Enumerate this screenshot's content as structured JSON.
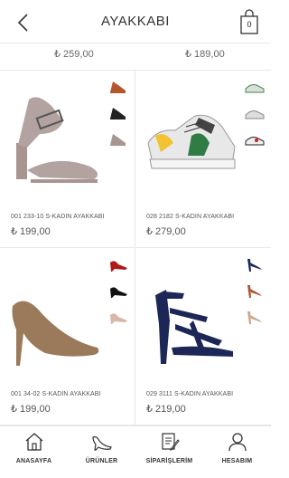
{
  "header": {
    "title": "AYAKKABI",
    "cart_count": "0"
  },
  "previous_row": {
    "prices": [
      "₺ 259,00",
      "₺ 189,00"
    ]
  },
  "products": [
    {
      "name": "001 233-10 S-KADIN AYAKKABI",
      "price": "₺ 199,00",
      "image": "block-heel-sandal-icon",
      "colors": [
        "#b5562c",
        "#222222",
        "#a89592"
      ]
    },
    {
      "name": "028 2182 S-KADIN AYAKKABI",
      "price": "₺ 279,00",
      "image": "sneaker-icon",
      "colors": [
        "#3a8a4a",
        "#888888",
        "#cc2222"
      ]
    },
    {
      "name": "001 34-02 S-KADIN AYAKKABI",
      "price": "₺ 199,00",
      "image": "pump-heel-icon",
      "colors": [
        "#b01a1a",
        "#111111",
        "#d8b6a8"
      ]
    },
    {
      "name": "029 3111 S-KADIN AYAKKABI",
      "price": "₺ 219,00",
      "image": "strappy-heel-icon",
      "colors": [
        "#1d2757",
        "#a8552e",
        "#c9a488"
      ]
    }
  ],
  "bottom_nav": [
    {
      "label": "ANASAYFA",
      "icon": "home-icon"
    },
    {
      "label": "ÜRÜNLER",
      "icon": "heel-shoe-icon"
    },
    {
      "label": "SİPARİŞLERİM",
      "icon": "orders-icon"
    },
    {
      "label": "HESABIM",
      "icon": "user-icon"
    }
  ]
}
